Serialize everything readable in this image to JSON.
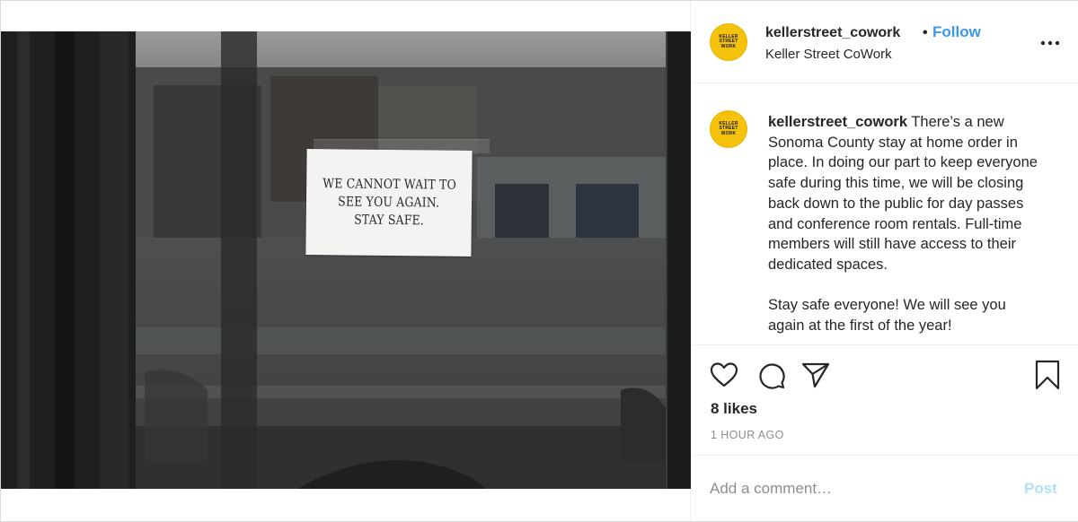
{
  "photo": {
    "sign_lines": [
      "WE CANNOT WAIT TO",
      "SEE YOU AGAIN.",
      "STAY SAFE."
    ]
  },
  "account": {
    "username": "kellerstreet_cowork",
    "location": "Keller Street CoWork",
    "follow_label": "Follow",
    "separator": "•",
    "avatar_text": [
      "KELLER",
      "STREET",
      "WORK"
    ]
  },
  "caption": {
    "username": "kellerstreet_cowork",
    "paragraph_1": "There’s a new Sonoma County stay at home order in place. In doing our part to keep everyone safe during this time, we will be closing back down to the public for day passes and conference room rentals. Full-time members will still have access to their dedicated spaces.",
    "paragraph_2": "Stay safe everyone! We will see you again at the first of the year!"
  },
  "actions": {
    "likes": "8 likes",
    "timestamp": "1 HOUR AGO"
  },
  "comment": {
    "placeholder": "Add a comment…",
    "post_label": "Post"
  },
  "colors": {
    "accent": "#3897f0",
    "post_disabled": "#b2dffc",
    "avatar_bg": "#f4c20d"
  }
}
